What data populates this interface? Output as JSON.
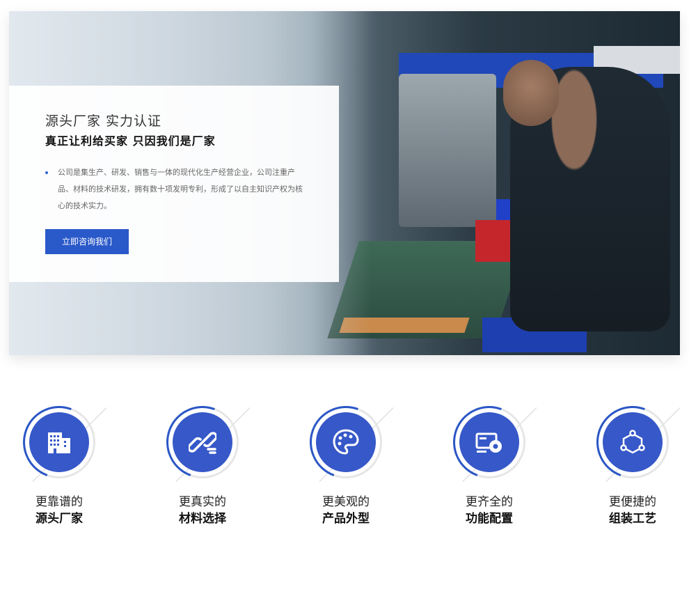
{
  "banner": {
    "title": "源头厂家 实力认证",
    "subtitle": "真正让利给买家 只因我们是厂家",
    "description": "公司是集生产、研发、销售与一体的现代化生产经营企业，公司注重产品、材料的技术研发，拥有数十项发明专利，形成了以自主知识产权为核心的技术实力。",
    "button_label": "立即咨询我们"
  },
  "features": [
    {
      "line1": "更靠谱的",
      "line2": "源头厂家",
      "icon": "building-icon"
    },
    {
      "line1": "更真实的",
      "line2": "材料选择",
      "icon": "link-icon"
    },
    {
      "line1": "更美观的",
      "line2": "产品外型",
      "icon": "palette-icon"
    },
    {
      "line1": "更齐全的",
      "line2": "功能配置",
      "icon": "gear-card-icon"
    },
    {
      "line1": "更便捷的",
      "line2": "组装工艺",
      "icon": "nodes-icon"
    }
  ],
  "colors": {
    "accent": "#3658c8",
    "button": "#2a59c9"
  }
}
